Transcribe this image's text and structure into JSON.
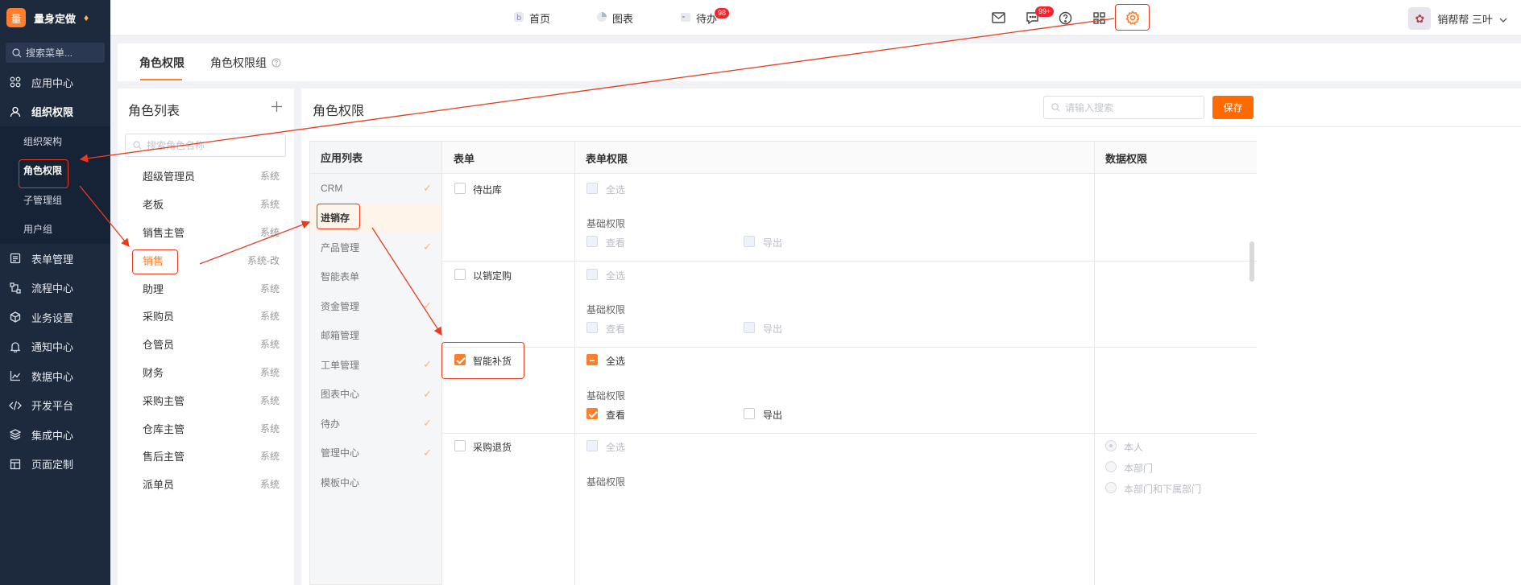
{
  "brand": {
    "logo_char": "量",
    "name": "量身定做"
  },
  "sidebar": {
    "search_placeholder": "搜索菜单...",
    "items": [
      {
        "label": "应用中心",
        "icon": "grid-icon"
      },
      {
        "label": "组织权限",
        "icon": "user-icon"
      },
      {
        "label": "表单管理",
        "icon": "form-icon"
      },
      {
        "label": "流程中心",
        "icon": "flow-icon"
      },
      {
        "label": "业务设置",
        "icon": "cube-icon"
      },
      {
        "label": "通知中心",
        "icon": "bell-icon"
      },
      {
        "label": "数据中心",
        "icon": "chart-icon"
      },
      {
        "label": "开发平台",
        "icon": "code-icon"
      },
      {
        "label": "集成中心",
        "icon": "layers-icon"
      },
      {
        "label": "页面定制",
        "icon": "layout-icon"
      }
    ],
    "sub_items": [
      "组织架构",
      "角色权限",
      "子管理组",
      "用户组"
    ]
  },
  "topbar": {
    "nav": [
      {
        "label": "首页",
        "icon": "home-icon"
      },
      {
        "label": "图表",
        "icon": "pie-icon"
      },
      {
        "label": "待办",
        "icon": "calendar-icon",
        "badge": "98"
      }
    ],
    "message_badge": "99+",
    "user_name": "销帮帮 三叶"
  },
  "tabs": {
    "role_permission": "角色权限",
    "role_group": "角色权限组"
  },
  "role_list": {
    "title": "角色列表",
    "search_placeholder": "搜索角色名称",
    "roles": [
      {
        "name": "超级管理员",
        "tag": "系统"
      },
      {
        "name": "老板",
        "tag": "系统"
      },
      {
        "name": "销售主管",
        "tag": "系统"
      },
      {
        "name": "销售",
        "tag": "系统-改"
      },
      {
        "name": "助理",
        "tag": "系统"
      },
      {
        "name": "采购员",
        "tag": "系统"
      },
      {
        "name": "仓管员",
        "tag": "系统"
      },
      {
        "name": "财务",
        "tag": "系统"
      },
      {
        "name": "采购主管",
        "tag": "系统"
      },
      {
        "name": "仓库主管",
        "tag": "系统"
      },
      {
        "name": "售后主管",
        "tag": "系统"
      },
      {
        "name": "派单员",
        "tag": "系统"
      }
    ]
  },
  "perm": {
    "title": "角色权限",
    "search_placeholder": "请输入搜索",
    "save_label": "保存",
    "headers": {
      "app_list": "应用列表",
      "form": "表单",
      "form_perm": "表单权限",
      "data_perm": "数据权限"
    },
    "apps": [
      "CRM",
      "进销存",
      "产品管理",
      "智能表单",
      "资金管理",
      "邮箱管理",
      "工单管理",
      "图表中心",
      "待办",
      "管理中心",
      "模板中心"
    ],
    "select_all": "全选",
    "basic_perm": "基础权限",
    "view": "查看",
    "export": "导出",
    "forms": [
      "待出库",
      "以销定购",
      "智能补货",
      "采购退货"
    ],
    "data_scopes": [
      "本人",
      "本部门",
      "本部门和下属部门"
    ]
  },
  "colors": {
    "accent": "#ff7d2b",
    "sidebar_bg": "#1d2a3e",
    "annotation": "#e83a1f"
  }
}
